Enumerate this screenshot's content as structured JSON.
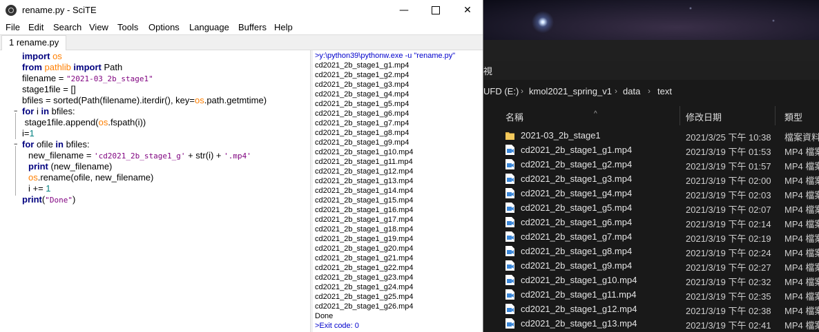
{
  "scite": {
    "title": "rename.py - SciTE",
    "window_controls": {
      "minimize": "—",
      "close": "✕"
    },
    "menu": [
      "File",
      "Edit",
      "Search",
      "View",
      "Tools",
      "Options",
      "Language",
      "Buffers",
      "Help"
    ],
    "tab": "1 rename.py",
    "code": {
      "line1": {
        "kw1": "import",
        "mod": " os"
      },
      "line2": {
        "kw1": "from",
        "mod": " pathlib",
        "kw2": " import",
        "rest": " Path"
      },
      "line3": {
        "pre": "filename = ",
        "str": "\"2021-03_2b_stage1\""
      },
      "line4": {
        "pre": "stage1file = []"
      },
      "line5": {
        "pre": "bfiles = sorted(Path(filename).iterdir(), key=",
        "mod": "os",
        "post": ".path.getmtime)"
      },
      "line6": {
        "kw1": "for",
        "mid": " i ",
        "kw2": "in",
        "post": " bfiles:"
      },
      "line7": {
        "pre": " stage1file.append(",
        "mod": "os",
        "post": ".fspath(i))"
      },
      "line8": {
        "pre": "i=",
        "num": "1"
      },
      "line9": {
        "kw1": "for",
        "mid": " ofile ",
        "kw2": "in",
        "post": " bfiles:"
      },
      "line10": {
        "pre": "new_filename = ",
        "str1": "'cd2021_2b_stage1_g'",
        "mid": " + str(i) + ",
        "str2": "'.mp4'"
      },
      "line11": {
        "kw1": "print",
        "post": " (new_filename)"
      },
      "line12": {
        "mod": "os",
        "post": ".rename(ofile, new_filename)"
      },
      "line13": {
        "pre": "i += ",
        "num": "1"
      },
      "line14": {
        "kw1": "print",
        "pre": "(",
        "str": "\"Done\"",
        "post": ")"
      }
    },
    "output": {
      "command": ">y:\\python39\\pythonw.exe -u \"rename.py\"",
      "lines": [
        "cd2021_2b_stage1_g1.mp4",
        "cd2021_2b_stage1_g2.mp4",
        "cd2021_2b_stage1_g3.mp4",
        "cd2021_2b_stage1_g4.mp4",
        "cd2021_2b_stage1_g5.mp4",
        "cd2021_2b_stage1_g6.mp4",
        "cd2021_2b_stage1_g7.mp4",
        "cd2021_2b_stage1_g8.mp4",
        "cd2021_2b_stage1_g9.mp4",
        "cd2021_2b_stage1_g10.mp4",
        "cd2021_2b_stage1_g11.mp4",
        "cd2021_2b_stage1_g12.mp4",
        "cd2021_2b_stage1_g13.mp4",
        "cd2021_2b_stage1_g14.mp4",
        "cd2021_2b_stage1_g15.mp4",
        "cd2021_2b_stage1_g16.mp4",
        "cd2021_2b_stage1_g17.mp4",
        "cd2021_2b_stage1_g18.mp4",
        "cd2021_2b_stage1_g19.mp4",
        "cd2021_2b_stage1_g20.mp4",
        "cd2021_2b_stage1_g21.mp4",
        "cd2021_2b_stage1_g22.mp4",
        "cd2021_2b_stage1_g23.mp4",
        "cd2021_2b_stage1_g24.mp4",
        "cd2021_2b_stage1_g25.mp4",
        "cd2021_2b_stage1_g26.mp4",
        "Done"
      ],
      "exit": ">Exit code: 0"
    }
  },
  "explorer": {
    "ribbon_char": "視",
    "breadcrumb": [
      "UFD (E:)",
      "kmol2021_spring_v1",
      "data",
      "text"
    ],
    "breadcrumb_sep": "›",
    "columns": {
      "name": "名稱",
      "date": "修改日期",
      "type": "類型"
    },
    "files": [
      {
        "name": "2021-03_2b_stage1",
        "date": "2021/3/25 下午 10:38",
        "type": "檔案資料",
        "icon": "folder-icon"
      },
      {
        "name": "cd2021_2b_stage1_g1.mp4",
        "date": "2021/3/19 下午 01:53",
        "type": "MP4 檔案",
        "icon": "video-file-icon"
      },
      {
        "name": "cd2021_2b_stage1_g2.mp4",
        "date": "2021/3/19 下午 01:57",
        "type": "MP4 檔案",
        "icon": "video-file-icon"
      },
      {
        "name": "cd2021_2b_stage1_g3.mp4",
        "date": "2021/3/19 下午 02:00",
        "type": "MP4 檔案",
        "icon": "video-file-icon"
      },
      {
        "name": "cd2021_2b_stage1_g4.mp4",
        "date": "2021/3/19 下午 02:03",
        "type": "MP4 檔案",
        "icon": "video-file-icon"
      },
      {
        "name": "cd2021_2b_stage1_g5.mp4",
        "date": "2021/3/19 下午 02:07",
        "type": "MP4 檔案",
        "icon": "video-file-icon"
      },
      {
        "name": "cd2021_2b_stage1_g6.mp4",
        "date": "2021/3/19 下午 02:14",
        "type": "MP4 檔案",
        "icon": "video-file-icon"
      },
      {
        "name": "cd2021_2b_stage1_g7.mp4",
        "date": "2021/3/19 下午 02:19",
        "type": "MP4 檔案",
        "icon": "video-file-icon"
      },
      {
        "name": "cd2021_2b_stage1_g8.mp4",
        "date": "2021/3/19 下午 02:24",
        "type": "MP4 檔案",
        "icon": "video-file-icon"
      },
      {
        "name": "cd2021_2b_stage1_g9.mp4",
        "date": "2021/3/19 下午 02:27",
        "type": "MP4 檔案",
        "icon": "video-file-icon"
      },
      {
        "name": "cd2021_2b_stage1_g10.mp4",
        "date": "2021/3/19 下午 02:32",
        "type": "MP4 檔案",
        "icon": "video-file-icon"
      },
      {
        "name": "cd2021_2b_stage1_g11.mp4",
        "date": "2021/3/19 下午 02:35",
        "type": "MP4 檔案",
        "icon": "video-file-icon"
      },
      {
        "name": "cd2021_2b_stage1_g12.mp4",
        "date": "2021/3/19 下午 02:38",
        "type": "MP4 檔案",
        "icon": "video-file-icon"
      },
      {
        "name": "cd2021_2b_stage1_g13.mp4",
        "date": "2021/3/19 下午 02:41",
        "type": "MP4 檔案",
        "icon": "video-file-icon"
      }
    ]
  },
  "colors": {
    "keyword": "#00007f",
    "module": "#ff7f00",
    "string": "#7f007f",
    "number": "#007f7f",
    "output_command": "#0000cc",
    "folder": "#e8b84a",
    "video_icon": "#3a86d8"
  }
}
